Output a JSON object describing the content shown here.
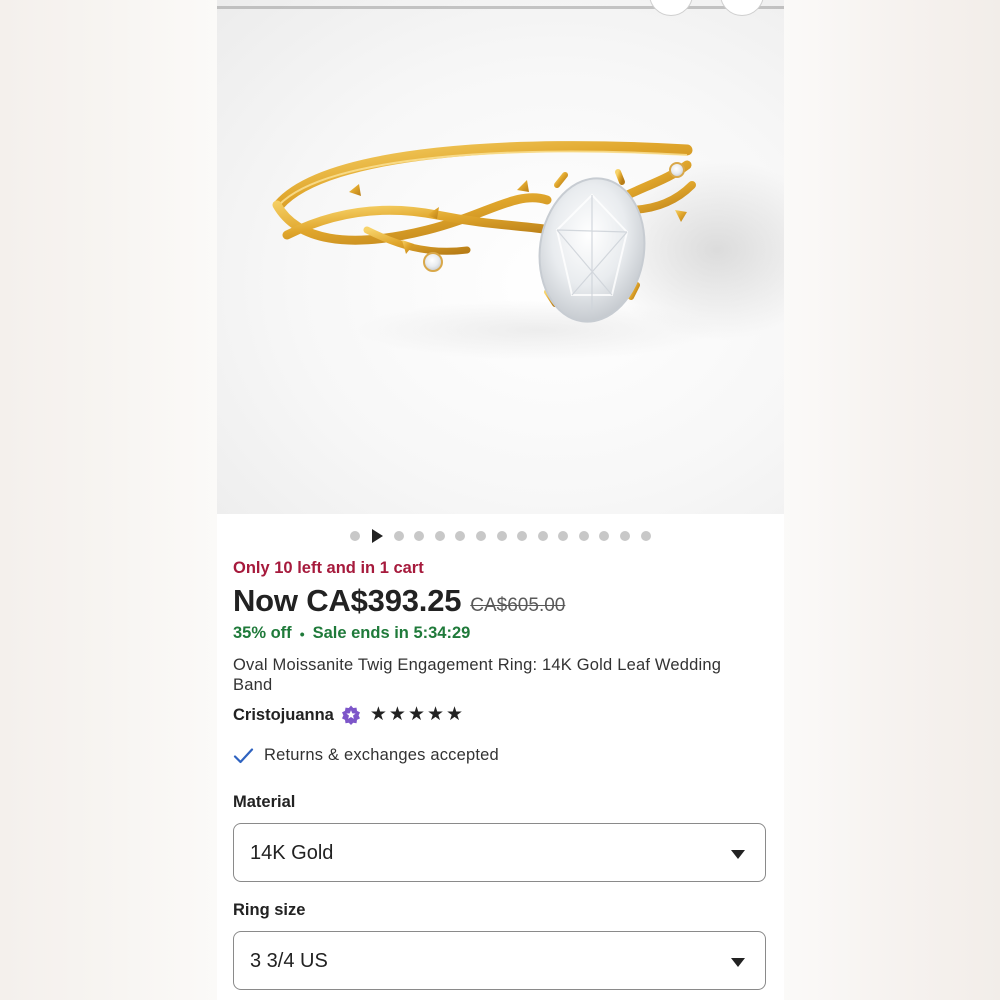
{
  "gallery": {
    "dot_count": 15,
    "active_index": 1
  },
  "listing": {
    "stock_notice": "Only 10 left and in 1 cart",
    "price_now": "Now CA$393.25",
    "price_original": "CA$605.00",
    "discount": "35% off",
    "separator": "•",
    "sale_timer": "Sale ends in 5:34:29",
    "title": "Oval Moissanite Twig Engagement Ring: 14K Gold Leaf Wedding Band",
    "shop_name": "Cristojuanna",
    "rating_stars": 5,
    "returns_text": "Returns & exchanges accepted"
  },
  "options": {
    "material_label": "Material",
    "material_value": "14K Gold",
    "ring_size_label": "Ring size",
    "ring_size_value": "3 3/4 US"
  },
  "colors": {
    "stock_red": "#a61a3c",
    "sale_green": "#1f7a3a",
    "check_blue": "#2f63c0",
    "badge_purple": "#7d56c9"
  },
  "icons": [
    "play-icon",
    "star-seller-badge-icon",
    "star-icon",
    "check-icon",
    "caret-down-icon"
  ]
}
